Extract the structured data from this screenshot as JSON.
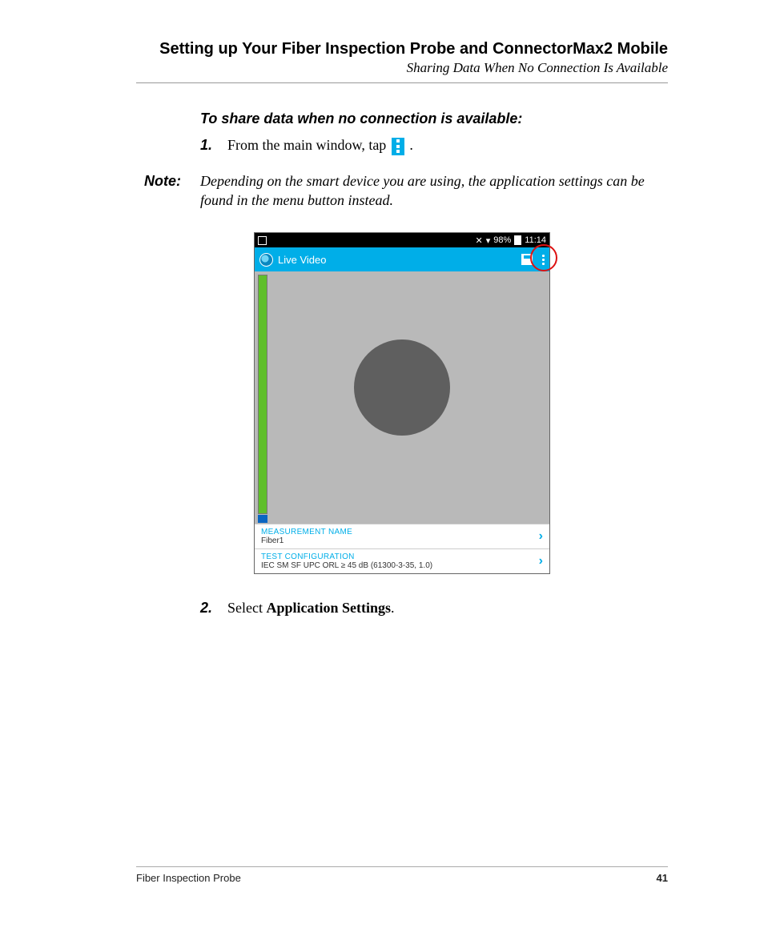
{
  "header": {
    "chapter": "Setting up Your Fiber Inspection Probe and ConnectorMax2 Mobile",
    "section": "Sharing Data When No Connection Is Available"
  },
  "lead": "To share data when no connection is available:",
  "steps": {
    "s1": {
      "num": "1.",
      "text_a": "From the main window, tap ",
      "text_b": "."
    },
    "s2": {
      "num": "2.",
      "text_a": "Select ",
      "bold": "Application Settings",
      "text_b": "."
    }
  },
  "note": {
    "label": "Note:",
    "text": "Depending on the smart device you are using, the application settings can be found in the menu button instead."
  },
  "phone": {
    "status": {
      "battery_pct": "98%",
      "time": "11:14"
    },
    "appbar": {
      "title": "Live Video"
    },
    "rows": {
      "measurement": {
        "label": "MEASUREMENT NAME",
        "value": "Fiber1"
      },
      "testconfig": {
        "label": "TEST CONFIGURATION",
        "value": "IEC SM SF UPC ORL ≥ 45 dB (61300-3-35, 1.0)"
      }
    }
  },
  "footer": {
    "product": "Fiber Inspection Probe",
    "page": "41"
  }
}
